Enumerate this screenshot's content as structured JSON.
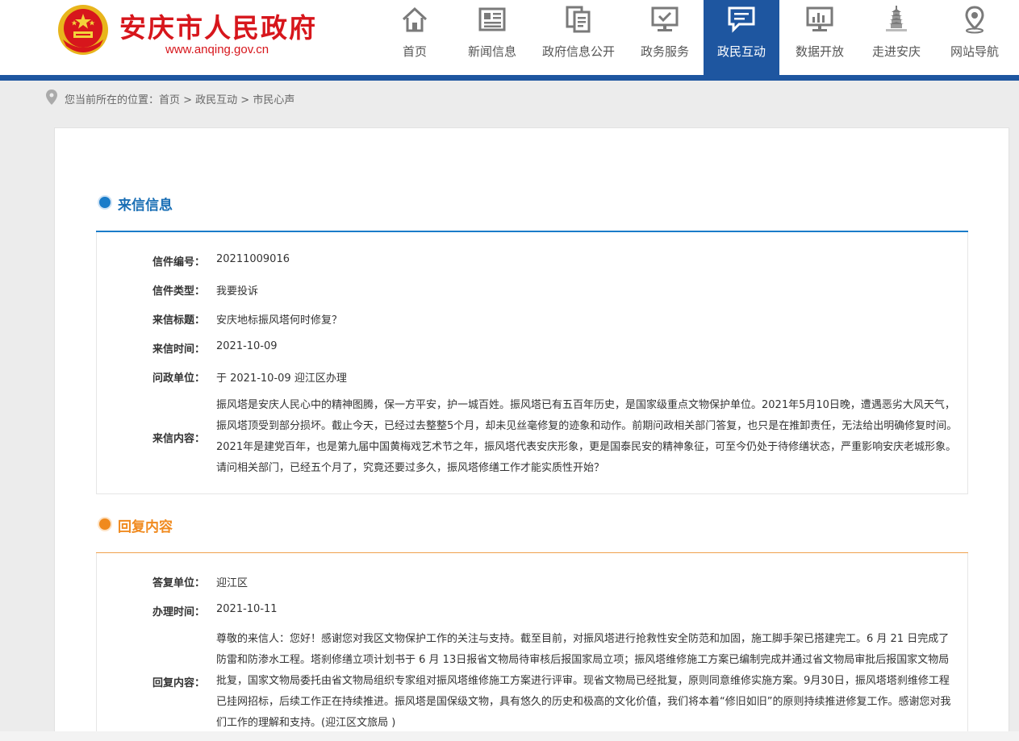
{
  "header": {
    "site_title": "安庆市人民政府",
    "site_url": "www.anqing.gov.cn",
    "nav": [
      {
        "label": "首页",
        "icon": "home-icon",
        "active": false
      },
      {
        "label": "新闻信息",
        "icon": "news-icon",
        "active": false
      },
      {
        "label": "政府信息公开",
        "icon": "documents-icon",
        "active": false
      },
      {
        "label": "政务服务",
        "icon": "monitor-check-icon",
        "active": false
      },
      {
        "label": "政民互动",
        "icon": "chat-icon",
        "active": true
      },
      {
        "label": "数据开放",
        "icon": "bar-chart-icon",
        "active": false
      },
      {
        "label": "走进安庆",
        "icon": "pagoda-icon",
        "active": false
      },
      {
        "label": "网站导航",
        "icon": "map-pin-icon",
        "active": false
      }
    ]
  },
  "breadcrumb": "您当前所在的位置：首页 > 政民互动 > 市民心声",
  "letter": {
    "section_title": "来信信息",
    "fields": [
      {
        "label": "信件编号：",
        "value": "20211009016"
      },
      {
        "label": "信件类型：",
        "value": "我要投诉"
      },
      {
        "label": "来信标题：",
        "value": "安庆地标振风塔何时修复？"
      },
      {
        "label": "来信时间：",
        "value": "2021-10-09"
      },
      {
        "label": "问政单位：",
        "value": "于 2021-10-09  迎江区办理"
      }
    ],
    "content_label": "来信内容：",
    "content": "振风塔是安庆人民心中的精神图腾，保一方平安，护一城百姓。振风塔已有五百年历史，是国家级重点文物保护单位。2021年5月10日晚，遭遇恶劣大风天气，振风塔顶受到部分损坏。截止今天，已经过去整整5个月，却未见丝毫修复的迹象和动作。前期问政相关部门答复，也只是在推卸责任，无法给出明确修复时间。2021年是建党百年，也是第九届中国黄梅戏艺术节之年，振风塔代表安庆形象，更是国泰民安的精神象征，可至今仍处于待修缮状态，严重影响安庆老城形象。请问相关部门，已经五个月了，究竟还要过多久，振风塔修缮工作才能实质性开始？"
  },
  "reply": {
    "section_title": "回复内容",
    "fields": [
      {
        "label": "答复单位：",
        "value": "迎江区"
      },
      {
        "label": "办理时间：",
        "value": "2021-10-11"
      }
    ],
    "content_label": "回复内容：",
    "content": "尊敬的来信人：您好！感谢您对我区文物保护工作的关注与支持。截至目前，对振风塔进行抢救性安全防范和加固，施工脚手架已搭建完工。6 月 21 日完成了防雷和防渗水工程。塔刹修缮立项计划书于 6 月 13日报省文物局待审核后报国家局立项；振风塔维修施工方案已编制完成并通过省文物局审批后报国家文物局批复，国家文物局委托由省文物局组织专家组对振风塔维修施工方案进行评审。现省文物局已经批复，原则同意维修实施方案。9月30日，振风塔塔刹维修工程已挂网招标，后续工作正在持续推进。振风塔是国保级文物，具有悠久的历史和极高的文化价值，我们将本着“修旧如旧”的原则持续推进修复工作。感谢您对我们工作的理解和支持。(迎江区文旅局 )"
  },
  "colors": {
    "brand_red": "#d7161c",
    "nav_blue": "#1e56a0",
    "letter_accent": "#1a7cc9",
    "reply_accent": "#f08a1e"
  }
}
